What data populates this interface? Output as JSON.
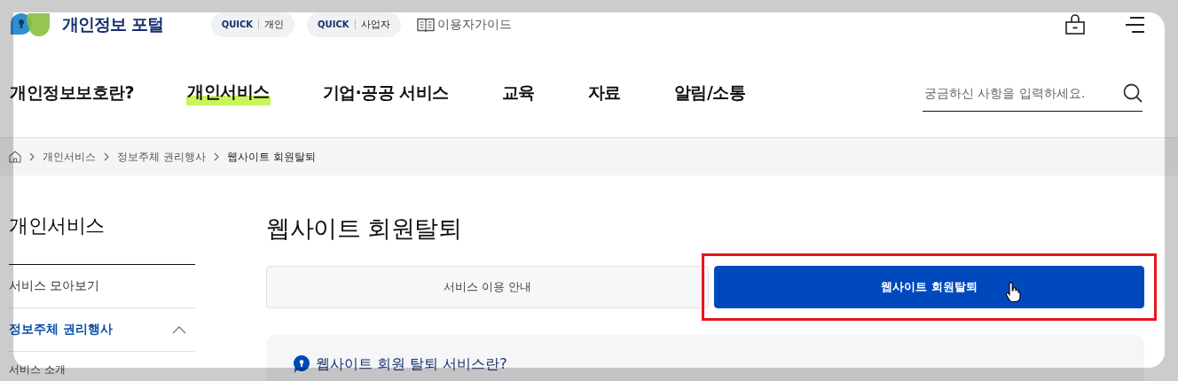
{
  "header": {
    "logo_text": "개인정보 포털",
    "quick_links": [
      {
        "prefix": "QUICK",
        "label": "개인"
      },
      {
        "prefix": "QUICK",
        "label": "사업자"
      }
    ],
    "guide_link": "이용자가이드"
  },
  "nav": {
    "items": [
      {
        "label": "개인정보보호란?",
        "selected": false
      },
      {
        "label": "개인서비스",
        "selected": true
      },
      {
        "label": "기업·공공 서비스",
        "selected": false
      },
      {
        "label": "교육",
        "selected": false
      },
      {
        "label": "자료",
        "selected": false
      },
      {
        "label": "알림/소통",
        "selected": false
      }
    ],
    "search": {
      "placeholder": "궁금하신 사항을 입력하세요."
    }
  },
  "breadcrumb": [
    "개인서비스",
    "정보주체 권리행사",
    "웹사이트 회원탈퇴"
  ],
  "sidebar": {
    "title": "개인서비스",
    "items": [
      {
        "label": "서비스 모아보기",
        "selected": false
      },
      {
        "label": "정보주체 권리행사",
        "selected": true,
        "expanded": true,
        "children": [
          {
            "label": "서비스 소개",
            "selected": false
          }
        ]
      }
    ]
  },
  "main": {
    "title": "웹사이트 회원탈퇴",
    "tabs": [
      {
        "label": "서비스 이용 안내",
        "selected": false
      },
      {
        "label": "웹사이트 회원탈퇴",
        "selected": true
      }
    ],
    "info_box": {
      "heading": "웹사이트 회원 탈퇴 서비스란?"
    }
  }
}
